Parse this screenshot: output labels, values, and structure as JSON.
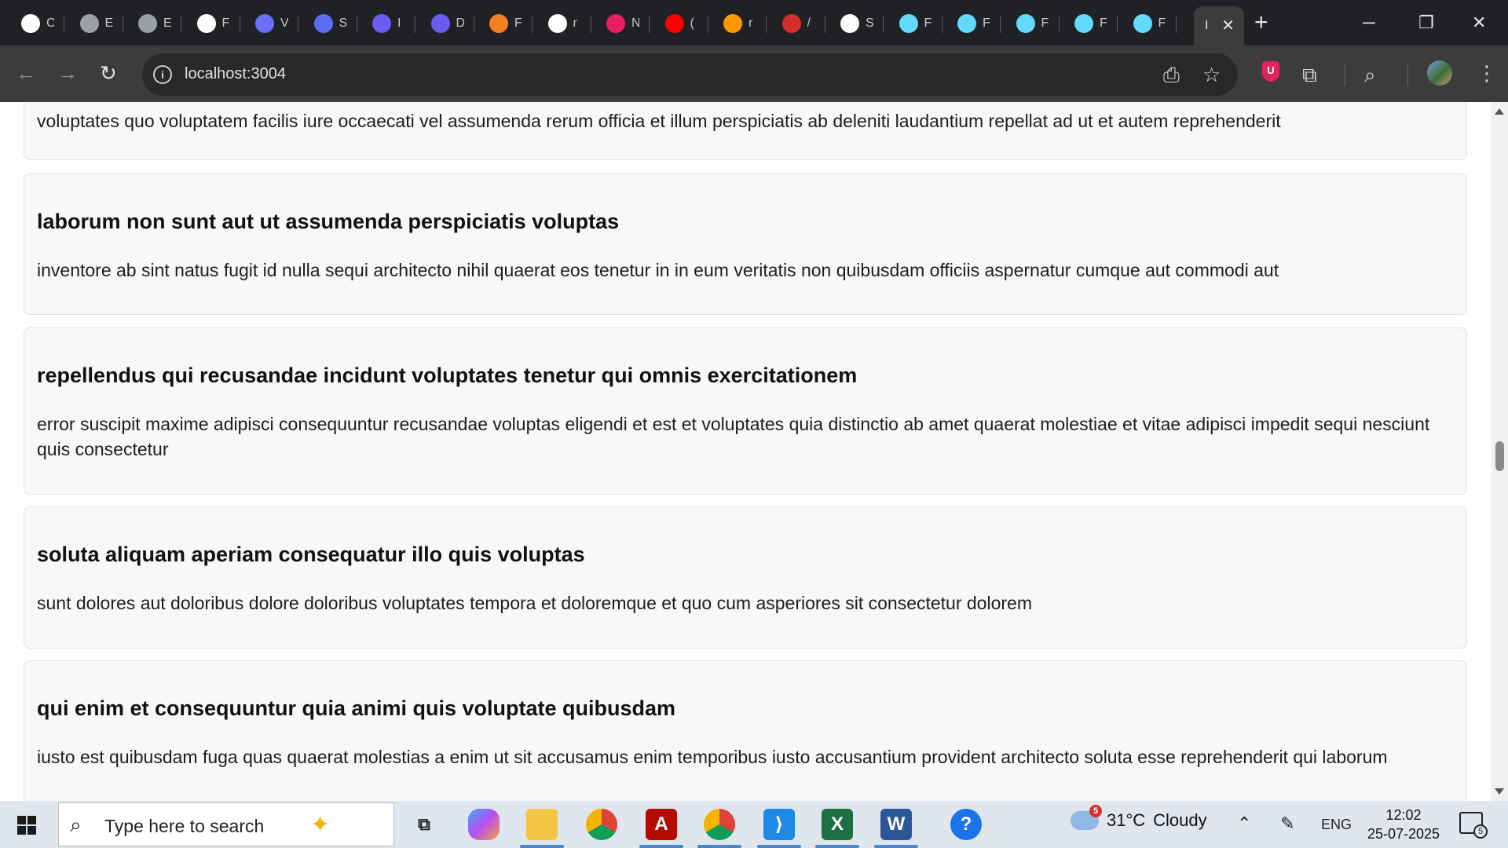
{
  "browser": {
    "tabs": [
      {
        "label": "C",
        "icon": "openai-icon",
        "color": "#ffffff"
      },
      {
        "label": "E",
        "icon": "globe-icon",
        "color": "#9aa0a6"
      },
      {
        "label": "E",
        "icon": "globe-icon",
        "color": "#9aa0a6"
      },
      {
        "label": "F",
        "icon": "openai-icon",
        "color": "#ffffff"
      },
      {
        "label": "V",
        "icon": "cube-icon",
        "color": "#6a6ff7"
      },
      {
        "label": "S",
        "icon": "cube-icon",
        "color": "#5b6cf5"
      },
      {
        "label": "I",
        "icon": "code-icon",
        "color": "#6b5cf0"
      },
      {
        "label": "D",
        "icon": "code-icon",
        "color": "#6b5cf0"
      },
      {
        "label": "F",
        "icon": "stack-icon",
        "color": "#f48024"
      },
      {
        "label": "r",
        "icon": "google-icon",
        "color": "#ffffff"
      },
      {
        "label": "N",
        "icon": "app-icon",
        "color": "#e91e63"
      },
      {
        "label": "(",
        "icon": "youtube-icon",
        "color": "#ff0000"
      },
      {
        "label": "r",
        "icon": "loop-icon",
        "color": "#ff9800"
      },
      {
        "label": "/",
        "icon": "target-icon",
        "color": "#d32f2f"
      },
      {
        "label": "S",
        "icon": "openai-icon",
        "color": "#ffffff"
      },
      {
        "label": "F",
        "icon": "react-icon",
        "color": "#61dafb"
      },
      {
        "label": "F",
        "icon": "react-icon",
        "color": "#61dafb"
      },
      {
        "label": "F",
        "icon": "react-icon",
        "color": "#61dafb"
      },
      {
        "label": "F",
        "icon": "react-icon",
        "color": "#61dafb"
      },
      {
        "label": "F",
        "icon": "react-icon",
        "color": "#61dafb"
      }
    ],
    "active_tab": {
      "label": "I"
    },
    "url": "localhost:3004"
  },
  "posts": [
    {
      "title": "",
      "body": "voluptates quo voluptatem facilis iure occaecati vel assumenda rerum officia et illum perspiciatis ab deleniti laudantium repellat ad ut et autem reprehenderit"
    },
    {
      "title": "laborum non sunt aut ut assumenda perspiciatis voluptas",
      "body": "inventore ab sint natus fugit id nulla sequi architecto nihil quaerat eos tenetur in in eum veritatis non quibusdam officiis aspernatur cumque aut commodi aut"
    },
    {
      "title": "repellendus qui recusandae incidunt voluptates tenetur qui omnis exercitationem",
      "body": "error suscipit maxime adipisci consequuntur recusandae voluptas eligendi et est et voluptates quia distinctio ab amet quaerat molestiae et vitae adipisci impedit sequi nesciunt quis consectetur"
    },
    {
      "title": "soluta aliquam aperiam consequatur illo quis voluptas",
      "body": "sunt dolores aut doloribus dolore doloribus voluptates tempora et doloremque et quo cum asperiores sit consectetur dolorem"
    },
    {
      "title": "qui enim et consequuntur quia animi quis voluptate quibusdam",
      "body": "iusto est quibusdam fuga quas quaerat molestias a enim ut sit accusamus enim temporibus iusto accusantium provident architecto soluta esse reprehenderit qui laborum"
    }
  ],
  "taskbar": {
    "search_placeholder": "Type here to search",
    "weather": {
      "temp": "31°C",
      "condition": "Cloudy",
      "badge": "5"
    },
    "language": "ENG",
    "time": "12:02",
    "date": "25-07-2025",
    "notifications": "5"
  }
}
